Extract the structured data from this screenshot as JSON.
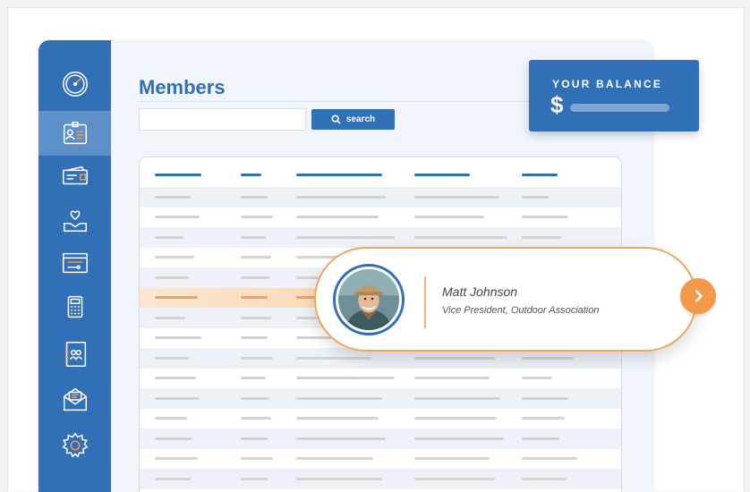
{
  "page": {
    "title": "Members"
  },
  "search": {
    "placeholder": "",
    "button_label": "search"
  },
  "sidebar": {
    "items": [
      {
        "icon": "speedometer-icon",
        "active": false
      },
      {
        "icon": "member-id-icon",
        "active": true
      },
      {
        "icon": "wallet-icon",
        "active": false
      },
      {
        "icon": "donation-icon",
        "active": false
      },
      {
        "icon": "website-icon",
        "active": false
      },
      {
        "icon": "calculator-icon",
        "active": false
      },
      {
        "icon": "contacts-book-icon",
        "active": false
      },
      {
        "icon": "mail-icon",
        "active": false
      },
      {
        "icon": "settings-icon",
        "active": false
      }
    ]
  },
  "balance": {
    "label": "YOUR BALANCE",
    "currency": "$"
  },
  "member_card": {
    "name": "Matt Johnson",
    "role": "Vice President, Outdoor Association",
    "avatar": "member-photo"
  },
  "colors": {
    "primary": "#3170b6",
    "accent": "#f2994a",
    "sidebar_active": "#5d8fc9"
  }
}
